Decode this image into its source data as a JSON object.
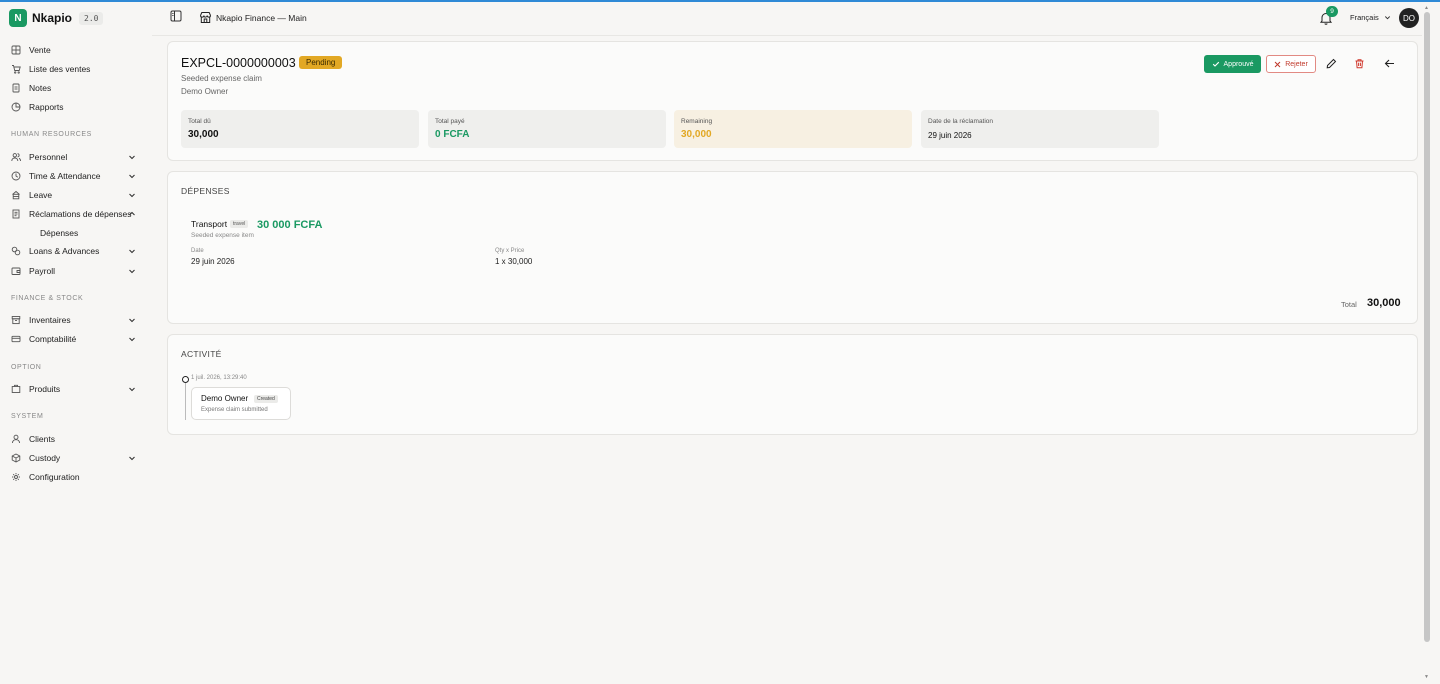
{
  "brand": {
    "name": "Nkapio",
    "version": "2.0"
  },
  "header": {
    "store_title": "Nkapio Finance — Main",
    "notifications": "9",
    "language": "Français",
    "avatar": "DO"
  },
  "sidebar": {
    "main": [
      {
        "label": "Vente",
        "icon": "grid-icon"
      },
      {
        "label": "Liste des ventes",
        "icon": "cart-icon"
      },
      {
        "label": "Notes",
        "icon": "note-icon"
      },
      {
        "label": "Rapports",
        "icon": "chart-icon"
      }
    ],
    "hr_label": "HUMAN RESOURCES",
    "hr": [
      {
        "label": "Personnel",
        "icon": "users-icon"
      },
      {
        "label": "Time & Attendance",
        "icon": "clock-icon"
      },
      {
        "label": "Leave",
        "icon": "calendar-icon"
      },
      {
        "label": "Réclamations de dépenses",
        "icon": "receipt-icon"
      },
      {
        "label": "Dépenses"
      },
      {
        "label": "Loans & Advances",
        "icon": "coins-icon"
      },
      {
        "label": "Payroll",
        "icon": "wallet-icon"
      }
    ],
    "finance_label": "FINANCE & STOCK",
    "finance": [
      {
        "label": "Inventaires",
        "icon": "box-icon"
      },
      {
        "label": "Comptabilité",
        "icon": "ledger-icon"
      }
    ],
    "option_label": "OPTION",
    "option": [
      {
        "label": "Produits",
        "icon": "package-icon"
      }
    ],
    "system_label": "SYSTEM",
    "system": [
      {
        "label": "Clients",
        "icon": "user-icon"
      },
      {
        "label": "Custody",
        "icon": "cube-icon"
      },
      {
        "label": "Configuration",
        "icon": "gear-icon"
      }
    ]
  },
  "claim": {
    "code": "EXPCL-0000000003",
    "status": "Pending",
    "description": "Seeded expense claim",
    "owner": "Demo Owner",
    "approve_label": "Approuvé",
    "reject_label": "Rejeter"
  },
  "stats": [
    {
      "label": "Total dû",
      "value": "30,000"
    },
    {
      "label": "Total payé",
      "value": "0 FCFA"
    },
    {
      "label": "Remaining",
      "value": "30,000"
    },
    {
      "label": "Date de la réclamation",
      "value": "29 juin 2026"
    }
  ],
  "expenses": {
    "title": "DÉPENSES",
    "item": {
      "name": "Transport",
      "tag": "travel",
      "amount": "30 000 FCFA",
      "description": "Seeded expense item",
      "date_label": "Date",
      "date": "29 juin 2026",
      "qty_label": "Qty x Price",
      "qty": "1 x 30,000"
    },
    "total_label": "Total",
    "total": "30,000"
  },
  "activity": {
    "title": "ACTIVITÉ",
    "time": "1 juil. 2026, 13:29:40",
    "user": "Demo Owner",
    "tag": "Created",
    "message": "Expense claim submitted"
  },
  "colors": {
    "accent": "#1a9962",
    "pending": "#e2a824",
    "reject": "#c0392b",
    "topline": "#2f8ad6"
  }
}
